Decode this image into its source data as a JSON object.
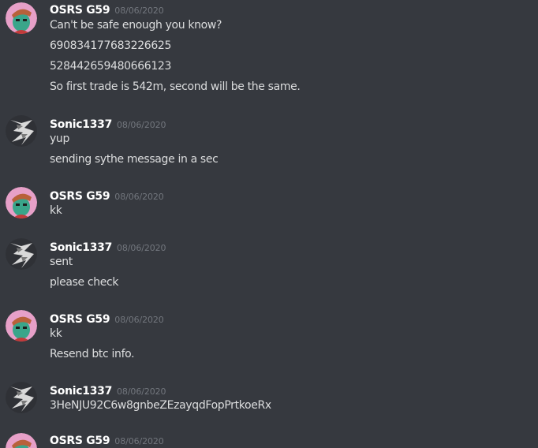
{
  "colors": {
    "background": "#36393f",
    "username": "#ffffff",
    "timestamp": "#72767d",
    "message_text": "#dcddde",
    "avatar_osrs_bg": "#e7a0c8",
    "avatar_sonic_bg": "#2f3136"
  },
  "messages": [
    {
      "author": "OSRS G59",
      "avatar": "osrs-avatar-icon",
      "timestamp": "08/06/2020",
      "lines": [
        "Can't be safe enough you know?",
        "690834177683226625",
        "528442659480666123",
        "So first trade is 542m, second will be the same."
      ]
    },
    {
      "author": "Sonic1337",
      "avatar": "sonic-avatar-icon",
      "timestamp": "08/06/2020",
      "lines": [
        "yup",
        "sending sythe message in a sec"
      ]
    },
    {
      "author": "OSRS G59",
      "avatar": "osrs-avatar-icon",
      "timestamp": "08/06/2020",
      "lines": [
        "kk"
      ]
    },
    {
      "author": "Sonic1337",
      "avatar": "sonic-avatar-icon",
      "timestamp": "08/06/2020",
      "lines": [
        "sent",
        "please check"
      ]
    },
    {
      "author": "OSRS G59",
      "avatar": "osrs-avatar-icon",
      "timestamp": "08/06/2020",
      "lines": [
        "kk",
        "Resend btc info."
      ]
    },
    {
      "author": "Sonic1337",
      "avatar": "sonic-avatar-icon",
      "timestamp": "08/06/2020",
      "lines": [
        "3HeNJU92C6w8gnbeZEzayqdFopPrtkoeRx"
      ]
    },
    {
      "author": "OSRS G59",
      "avatar": "osrs-avatar-icon",
      "timestamp": "08/06/2020",
      "lines": []
    }
  ]
}
